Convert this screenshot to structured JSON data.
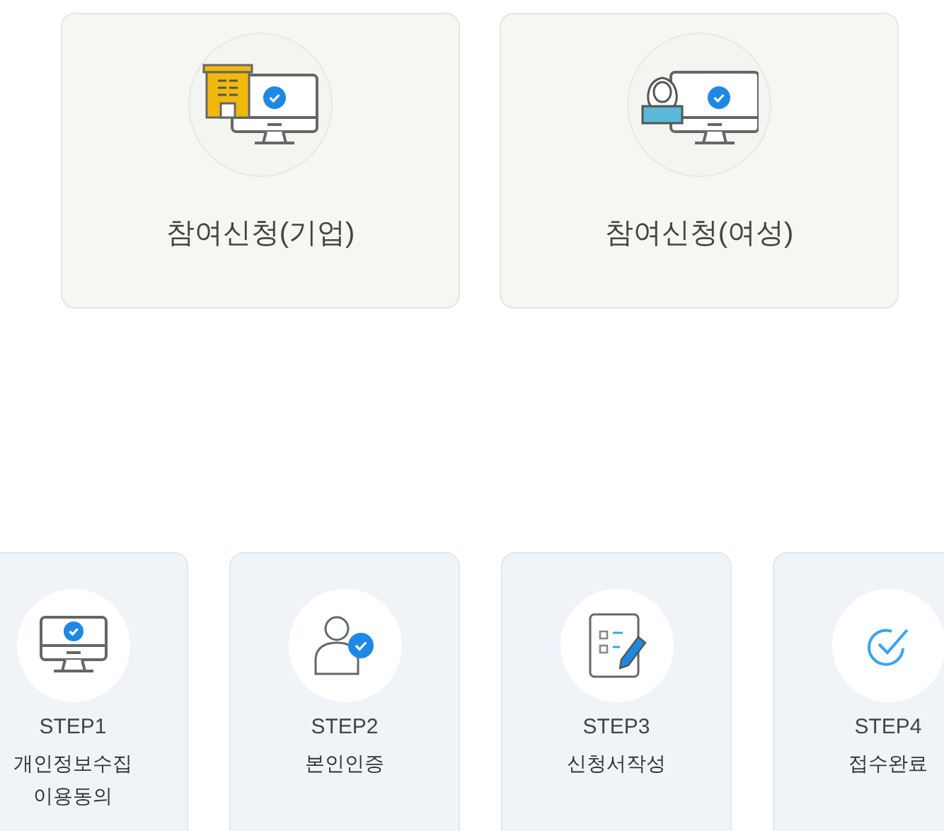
{
  "apply_cards": [
    {
      "kind": "company",
      "label": "참여신청(기업)"
    },
    {
      "kind": "woman",
      "label": "참여신청(여성)"
    }
  ],
  "steps": [
    {
      "kind": "monitor",
      "step": "STEP1",
      "label": "개인정보수집\n이용동의"
    },
    {
      "kind": "person",
      "step": "STEP2",
      "label": "본인인증"
    },
    {
      "kind": "form",
      "step": "STEP3",
      "label": "신청서작성"
    },
    {
      "kind": "check",
      "step": "STEP4",
      "label": "접수완료"
    }
  ]
}
